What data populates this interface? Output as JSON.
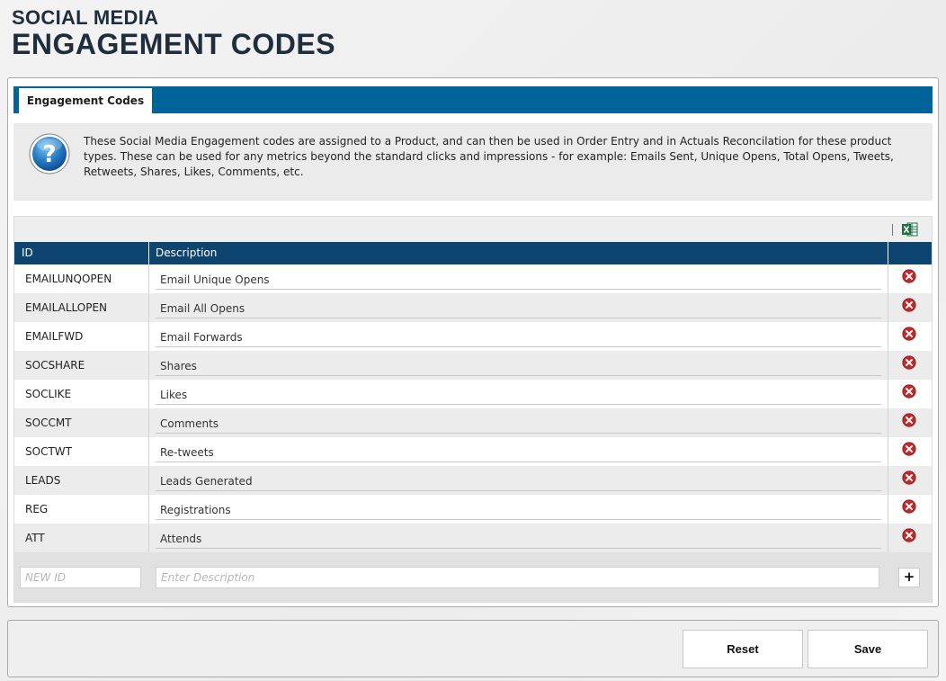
{
  "header": {
    "subtitle": "SOCIAL MEDIA",
    "title": "ENGAGEMENT CODES"
  },
  "tabs": [
    {
      "label": "Engagement Codes",
      "active": true
    }
  ],
  "info": {
    "icon": "help-icon",
    "text": "These Social Media Engagement codes are assigned to a Product, and can then be used in Order Entry and in Actuals Reconcilation for these product types. These can be used for any metrics beyond the standard clicks and impressions - for example: Emails Sent, Unique Opens, Total Opens, Tweets, Retweets, Shares, Likes, Comments, etc."
  },
  "grid": {
    "toolbar": {
      "export_icon": "excel-icon"
    },
    "columns": {
      "id": "ID",
      "description": "Description"
    },
    "rows": [
      {
        "id": "EMAILUNQOPEN",
        "description": "Email Unique Opens"
      },
      {
        "id": "EMAILALLOPEN",
        "description": "Email All Opens"
      },
      {
        "id": "EMAILFWD",
        "description": "Email Forwards"
      },
      {
        "id": "SOCSHARE",
        "description": "Shares"
      },
      {
        "id": "SOCLIKE",
        "description": "Likes"
      },
      {
        "id": "SOCCMT",
        "description": "Comments"
      },
      {
        "id": "SOCTWT",
        "description": "Re-tweets"
      },
      {
        "id": "LEADS",
        "description": "Leads Generated"
      },
      {
        "id": "REG",
        "description": "Registrations"
      },
      {
        "id": "ATT",
        "description": "Attends"
      }
    ],
    "delete_icon": "delete-icon",
    "new_row": {
      "id_placeholder": "NEW ID",
      "description_placeholder": "Enter Description",
      "add_label": "+"
    }
  },
  "footer": {
    "reset_label": "Reset",
    "save_label": "Save"
  },
  "colors": {
    "tabbar": "#006399",
    "header_row": "#0e4470",
    "title_text": "#1f2d3d",
    "delete_icon": "#c62828",
    "excel_green": "#1d7044"
  }
}
